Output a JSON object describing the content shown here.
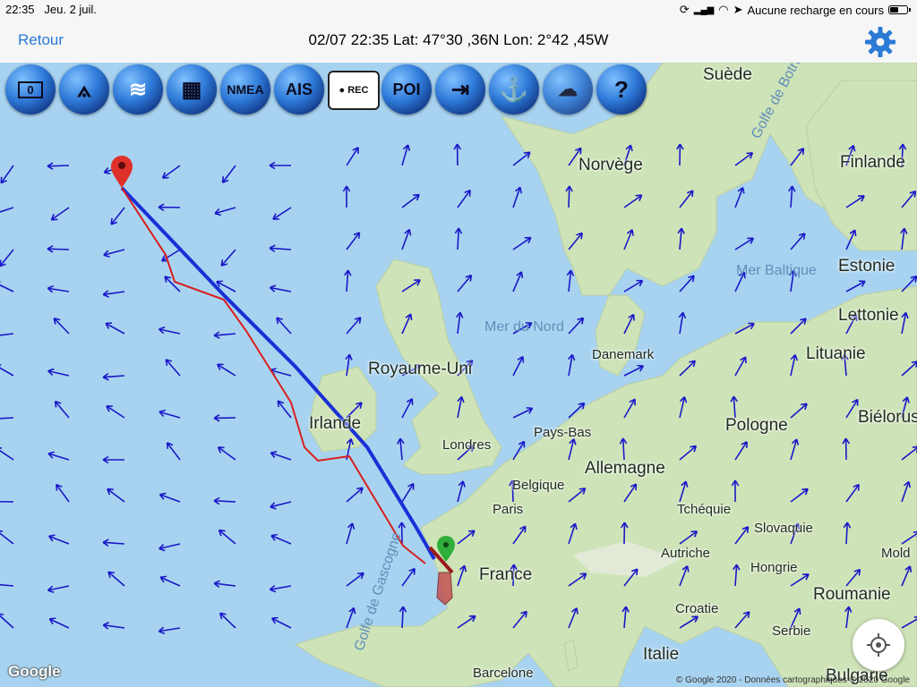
{
  "status_bar": {
    "time": "22:35",
    "date": "Jeu. 2 juil.",
    "charging_text": "Aucune recharge en cours"
  },
  "nav": {
    "back_label": "Retour",
    "title": "02/07 22:35  Lat: 47°30 ,36N Lon: 2°42 ,45W",
    "settings_icon": "gear-icon"
  },
  "toolbar": [
    {
      "name": "ruler",
      "label": "0",
      "icon": "ruler-icon"
    },
    {
      "name": "compass",
      "label": "",
      "icon": "compass-divider-icon"
    },
    {
      "name": "wind",
      "label": "",
      "icon": "wind-icon"
    },
    {
      "name": "charts",
      "label": "",
      "icon": "map-icon"
    },
    {
      "name": "nmea",
      "label": "NMEA",
      "icon": "nmea-icon"
    },
    {
      "name": "ais",
      "label": "AIS",
      "icon": "ais-icon"
    },
    {
      "name": "rec",
      "label": "● REC",
      "icon": "record-icon"
    },
    {
      "name": "poi",
      "label": "POI",
      "icon": "poi-icon"
    },
    {
      "name": "exit",
      "label": "",
      "icon": "exit-icon"
    },
    {
      "name": "anchor",
      "label": "",
      "icon": "anchor-icon"
    },
    {
      "name": "weather",
      "label": "",
      "icon": "weather-icon"
    },
    {
      "name": "help",
      "label": "?",
      "icon": "help-icon"
    }
  ],
  "map": {
    "labels": {
      "suede": "Suède",
      "finlande": "Finlande",
      "norvege": "Norvège",
      "golfe_botnie": "Golfe de Botnie",
      "mer_baltique": "Mer Baltique",
      "estonie": "Estonie",
      "lettonie": "Lettonie",
      "lituanie": "Lituanie",
      "mer_du_nord": "Mer du Nord",
      "danemark": "Danemark",
      "royaume_uni": "Royaume-Uni",
      "irlande": "Irlande",
      "londres": "Londres",
      "pays_bas": "Pays-Bas",
      "pologne": "Pologne",
      "bielorussie": "Biélorus",
      "allemagne": "Allemagne",
      "belgique": "Belgique",
      "paris": "Paris",
      "tcheque": "Tchéquie",
      "slovaquie": "Slovaquie",
      "autriche": "Autriche",
      "hongrie": "Hongrie",
      "moldavie": "Mold",
      "france": "France",
      "roumanie": "Roumanie",
      "croatie": "Croatie",
      "serbie": "Serbie",
      "golfe_gascogne": "Golfe de Gascogne",
      "italie": "Italie",
      "barcelone": "Barcelone",
      "bulgarie": "Bulgarie"
    },
    "attribution": "Google",
    "copyright": "© Google 2020 - Données cartographiques © 2020 Google",
    "colors": {
      "sea": "#a8d3f0",
      "land": "#cfe3b8",
      "route": "#1a2fd6",
      "track": "#d81e1e",
      "wind": "#1a18c8"
    }
  },
  "locate_icon": "locate-icon"
}
